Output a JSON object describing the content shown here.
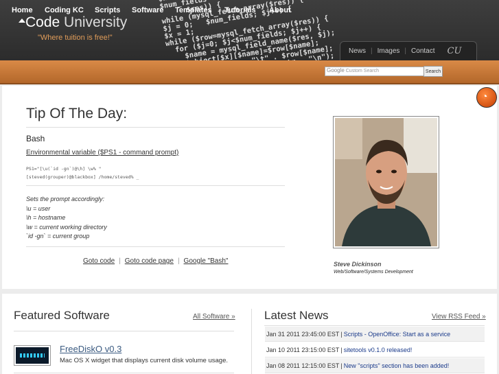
{
  "header": {
    "title_main": "Code",
    "title_light": "University",
    "tagline": "\"Where tuition is free!\"",
    "code_art": "$handle=fopen($fil...\n$num_fields = mysql_num_fiel\n      $res)) {\nwhile (mysql_fetch_array($res)) {\n$j = 0;   $num_fields; $j++) {\n$x = 1;\nwhile ($row=mysql_fetch_array($res)) {\n  for ($j=0; $j<$num_fields; $j++) {\n    $name = mysql_field_name($res, $j);\n    $object[$x][$name]=$row[$name];\n    $str = $name . \"\\t\" . $row[$name];\n    $str = $name . \":\" . $str . \"\\n\");\n    fwrite($handle, $str);",
    "top_links": [
      "News",
      "Images",
      "Contact"
    ],
    "logo_text": "CU"
  },
  "nav": {
    "items": [
      "Home",
      "Coding KC",
      "Scripts",
      "Software",
      "Templates",
      "Tutorials",
      "About"
    ],
    "search_placeholder_brand": "Google",
    "search_placeholder": "Custom Search",
    "search_button": "Search"
  },
  "tip": {
    "heading": "Tip Of The Day:",
    "subject": "Bash",
    "link_text": "Environmental variable ($PS1 - command prompt)",
    "code_lines": "PS1=\"[\\u(`id -gn`)@\\h] \\w% \"\n[steved(grouper)@blackbox] /home/steved% _",
    "notes": [
      "Sets the prompt accordingly:",
      "\\u = user",
      "\\h = hostname",
      "\\w = current working directory",
      "`id -gn` = current group"
    ],
    "actions": [
      "Goto code",
      "Goto code page",
      "Google \"Bash\""
    ]
  },
  "profile": {
    "name": "Steve Dickinson",
    "role": "Web/Software/Systems Development"
  },
  "featured": {
    "heading": "Featured Software",
    "all_link": "All Software »",
    "item_name": "FreeDiskO v0.3",
    "item_desc": "Mac OS X widget that displays current disk volume usage."
  },
  "news": {
    "heading": "Latest News",
    "rss_link": "View RSS Feed »",
    "items": [
      {
        "date": "Jan 31 2011 23:45:00 EST",
        "title": "Scripts - OpenOffice: Start as a service"
      },
      {
        "date": "Jan 10 2011 23:15:00 EST",
        "title": "sitetools v0.1.0 released!"
      },
      {
        "date": "Jan 08 2011 12:15:00 EST",
        "title": "New \"scripts\" section has been added!"
      }
    ]
  }
}
